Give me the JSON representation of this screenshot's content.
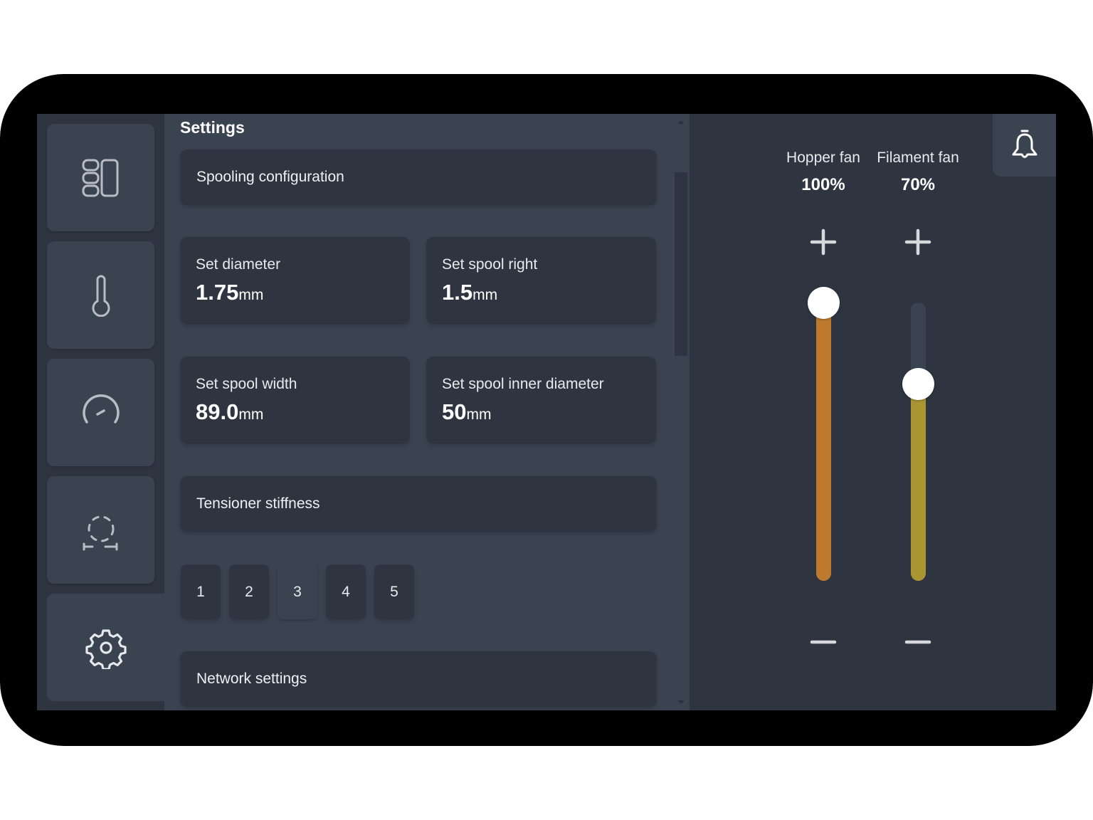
{
  "sidebar": {
    "items": [
      {
        "id": "dashboard",
        "icon": "layout-panels-icon",
        "active": false
      },
      {
        "id": "temperature",
        "icon": "thermometer-icon",
        "active": false
      },
      {
        "id": "speed",
        "icon": "gauge-icon",
        "active": false
      },
      {
        "id": "spool",
        "icon": "spool-dashed-icon",
        "active": false
      },
      {
        "id": "settings",
        "icon": "gear-icon",
        "active": true
      }
    ]
  },
  "main": {
    "title": "Settings",
    "sections": {
      "spooling": "Spooling configuration",
      "tensioner": "Tensioner stiffness",
      "network": "Network settings"
    },
    "cards": [
      {
        "label": "Set diameter",
        "value": "1.75",
        "unit": "mm"
      },
      {
        "label": "Set spool right",
        "value": "1.5",
        "unit": "mm"
      },
      {
        "label": "Set spool width",
        "value": "89.0",
        "unit": "mm"
      },
      {
        "label": "Set spool inner diameter",
        "value": "50",
        "unit": "mm"
      }
    ],
    "stiffness_options": [
      "1",
      "2",
      "3",
      "4",
      "5"
    ],
    "stiffness_selected": "3"
  },
  "fans": [
    {
      "label": "Hopper fan",
      "value_text": "100%",
      "value": 100,
      "color": "#bd7a2f"
    },
    {
      "label": "Filament fan",
      "value_text": "70%",
      "value": 70,
      "color": "#a99632"
    }
  ],
  "colors": {
    "screen_bg": "#2e3540",
    "panel_bg": "#3a4451",
    "icon": "#b9bdc3",
    "hopper_fan": "#bd7a2f",
    "filament_fan": "#a99632"
  },
  "notifications": {
    "icon": "bell-icon"
  }
}
